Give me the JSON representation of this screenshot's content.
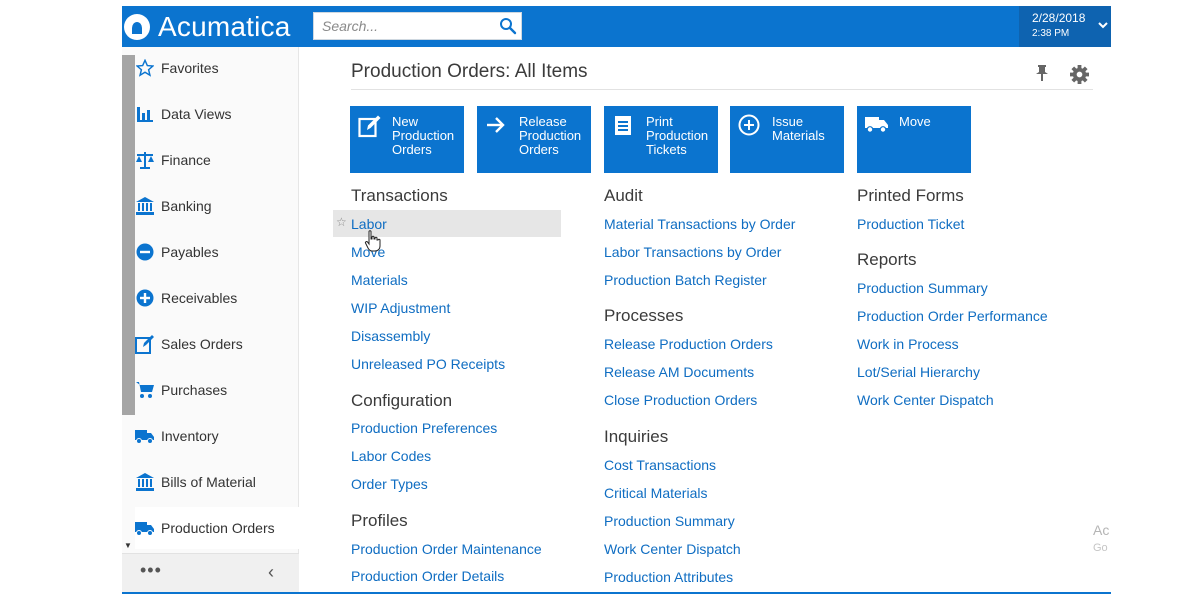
{
  "app": {
    "name": "Acumatica"
  },
  "search": {
    "placeholder": "Search..."
  },
  "datetime": {
    "date": "2/28/2018",
    "time": "2:38 PM"
  },
  "sidebar": {
    "items": [
      {
        "label": "Favorites",
        "icon": "star-icon"
      },
      {
        "label": "Data Views",
        "icon": "bar-chart-icon"
      },
      {
        "label": "Finance",
        "icon": "scales-icon"
      },
      {
        "label": "Banking",
        "icon": "bank-icon"
      },
      {
        "label": "Payables",
        "icon": "minus-circle-icon"
      },
      {
        "label": "Receivables",
        "icon": "plus-circle-icon"
      },
      {
        "label": "Sales Orders",
        "icon": "edit-icon"
      },
      {
        "label": "Purchases",
        "icon": "cart-icon"
      },
      {
        "label": "Inventory",
        "icon": "truck-icon"
      },
      {
        "label": "Bills of Material",
        "icon": "bank-icon"
      },
      {
        "label": "Production Orders",
        "icon": "truck-icon",
        "active": true
      }
    ],
    "more": "•••",
    "collapse": "‹"
  },
  "page": {
    "title": "Production Orders: All Items"
  },
  "tiles": [
    {
      "label": "New\nProduction\nOrders",
      "icon": "edit-icon"
    },
    {
      "label": "Release\nProduction\nOrders",
      "icon": "arrow-right-icon"
    },
    {
      "label": "Print\nProduction\nTickets",
      "icon": "document-icon"
    },
    {
      "label": "Issue\nMaterials",
      "icon": "plus-circle-icon"
    },
    {
      "label": "Move",
      "icon": "truck-icon"
    }
  ],
  "sections": {
    "transactions": {
      "title": "Transactions",
      "links": [
        "Labor",
        "Move",
        "Materials",
        "WIP Adjustment",
        "Disassembly",
        "Unreleased PO Receipts"
      ]
    },
    "configuration": {
      "title": "Configuration",
      "links": [
        "Production Preferences",
        "Labor Codes",
        "Order Types"
      ]
    },
    "profiles": {
      "title": "Profiles",
      "links": [
        "Production Order Maintenance",
        "Production Order Details"
      ]
    },
    "audit": {
      "title": "Audit",
      "links": [
        "Material Transactions by Order",
        "Labor Transactions by Order",
        "Production Batch Register"
      ]
    },
    "processes": {
      "title": "Processes",
      "links": [
        "Release Production Orders",
        "Release AM Documents",
        "Close Production Orders"
      ]
    },
    "inquiries": {
      "title": "Inquiries",
      "links": [
        "Cost Transactions",
        "Critical Materials",
        "Production Summary",
        "Work Center Dispatch",
        "Production Attributes"
      ]
    },
    "printed_forms": {
      "title": "Printed Forms",
      "links": [
        "Production Ticket"
      ]
    },
    "reports": {
      "title": "Reports",
      "links": [
        "Production Summary",
        "Production Order Performance",
        "Work in Process",
        "Lot/Serial Hierarchy",
        "Work Center Dispatch"
      ]
    }
  },
  "watermark": {
    "line1": "Ac",
    "line2": "Go"
  },
  "colors": {
    "brand": "#0b74cf",
    "link": "#0f6dc2",
    "date_box": "#0e63b0"
  }
}
